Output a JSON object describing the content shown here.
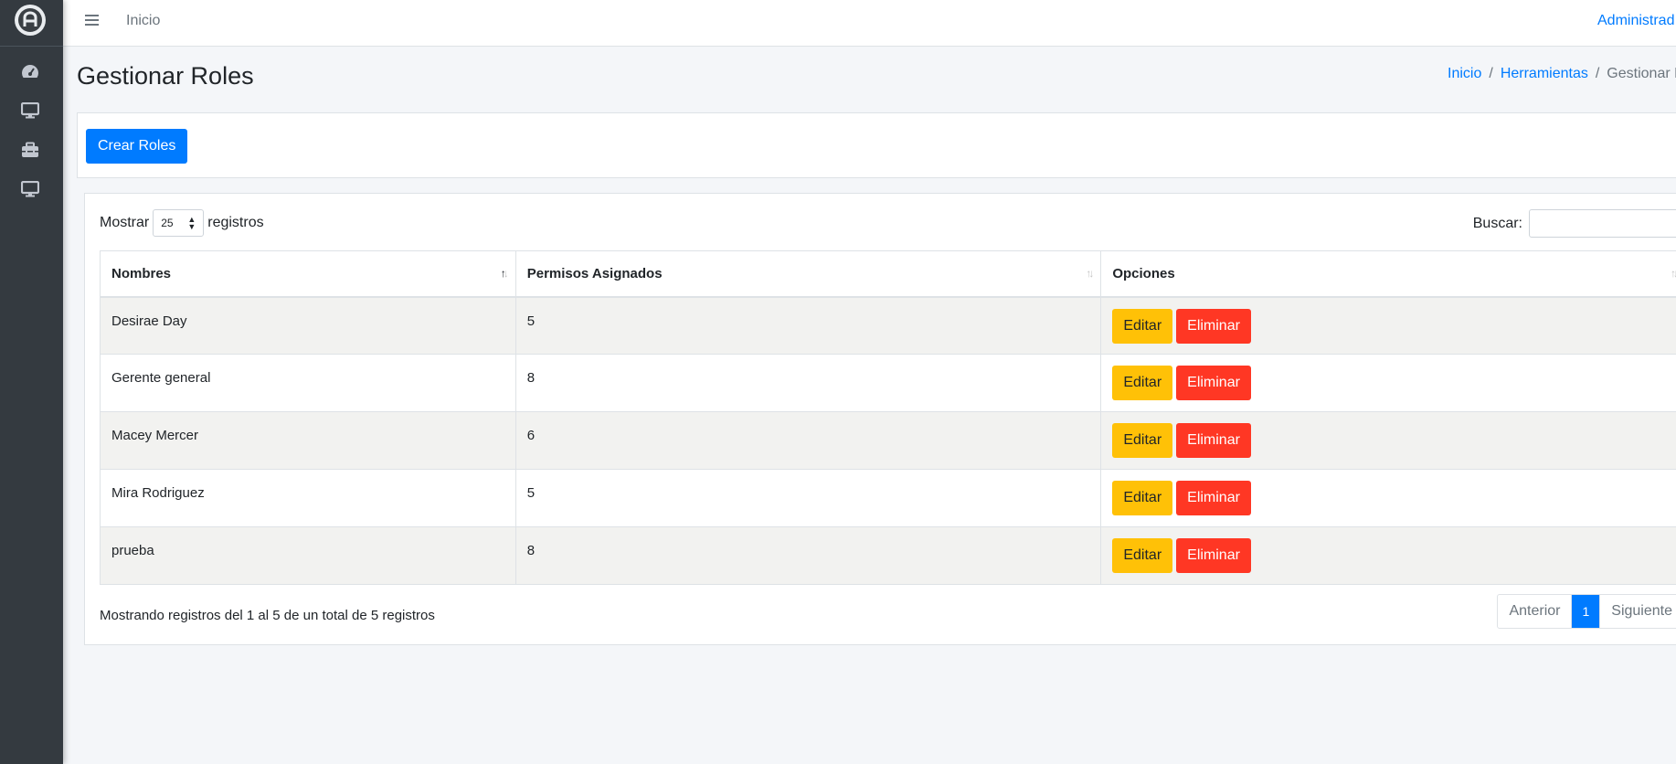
{
  "topbar": {
    "home_link": "Inicio",
    "user_label": "Administrad"
  },
  "page": {
    "title": "Gestionar Roles"
  },
  "breadcrumb": {
    "item1": "Inicio",
    "item2": "Herramientas",
    "current": "Gestionar Roles",
    "separator": "/"
  },
  "actions": {
    "create_label": "Crear Roles"
  },
  "table_controls": {
    "show_label": "Mostrar",
    "page_length": "25",
    "records_label": "registros",
    "search_label": "Buscar:",
    "search_value": ""
  },
  "table": {
    "headers": [
      "Nombres",
      "Permisos Asignados",
      "Opciones"
    ],
    "rows": [
      {
        "name": "Desirae Day",
        "permissions": "5"
      },
      {
        "name": "Gerente general",
        "permissions": "8"
      },
      {
        "name": "Macey Mercer",
        "permissions": "6"
      },
      {
        "name": "Mira Rodriguez",
        "permissions": "5"
      },
      {
        "name": "prueba",
        "permissions": "8"
      }
    ],
    "edit_label": "Editar",
    "delete_label": "Eliminar"
  },
  "footer": {
    "info": "Mostrando registros del 1 al 5 de un total de 5 registros",
    "prev_label": "Anterior",
    "current_page": "1",
    "next_label": "Siguiente"
  },
  "colors": {
    "primary": "#007bff",
    "warning": "#ffc107",
    "danger": "#ff3724",
    "sidebar": "#343a40"
  }
}
